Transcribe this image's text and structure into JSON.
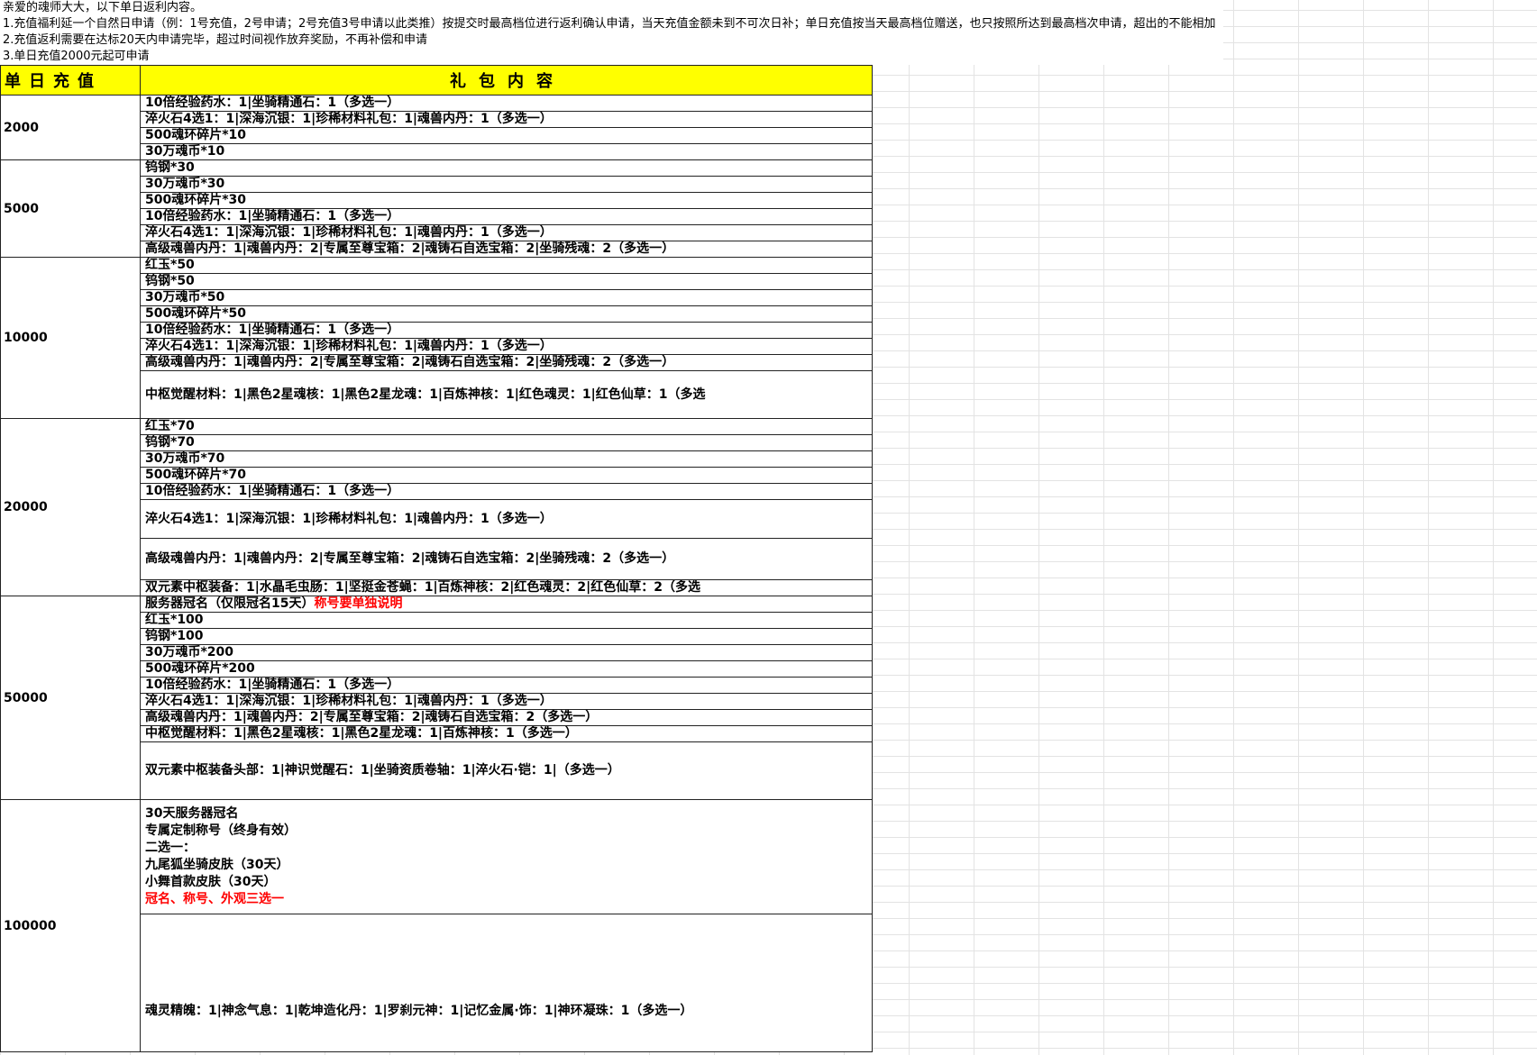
{
  "notes": [
    "亲爱的魂师大大，以下单日返利内容。",
    "1.充值福利延一个自然日申请（例：1号充值，2号申请；2号充值3号申请以此类推）按提交时最高档位进行返利确认申请，当天充值金额未到不可次日补；单日充值按当天最高档位赠送，也只按照所达到最高档次申请，超出的不能相加",
    "2.充值返利需要在达标20天内申请完毕，超过时间视作放弃奖励，不再补偿和申请",
    "3.单日充值2000元起可申请"
  ],
  "table": {
    "header_tier": "单日充值",
    "header_content": "礼包内容",
    "tiers": [
      {
        "amount": "2000",
        "items": [
          "10倍经验药水：1|坐骑精通石：1（多选一）",
          "淬火石4选1：1|深海沉银：1|珍稀材料礼包：1|魂兽内丹：1（多选一）",
          "500魂环碎片*10",
          "30万魂币*10"
        ]
      },
      {
        "amount": "5000",
        "items": [
          "钨钢*30",
          "30万魂币*30",
          "500魂环碎片*30",
          "10倍经验药水：1|坐骑精通石：1（多选一）",
          "淬火石4选1：1|深海沉银：1|珍稀材料礼包：1|魂兽内丹：1（多选一）",
          "高级魂兽内丹：1|魂兽内丹：2|专属至尊宝箱：2|魂铸石自选宝箱：2|坐骑残魂：2（多选一）"
        ]
      },
      {
        "amount": "10000",
        "items": [
          "红玉*50",
          "钨钢*50",
          "30万魂币*50",
          "500魂环碎片*50",
          "10倍经验药水：1|坐骑精通石：1（多选一）",
          "淬火石4选1：1|深海沉银：1|珍稀材料礼包：1|魂兽内丹：1（多选一）",
          "高级魂兽内丹：1|魂兽内丹：2|专属至尊宝箱：2|魂铸石自选宝箱：2|坐骑残魂：2（多选一）",
          "中枢觉醒材料：1|黑色2星魂核：1|黑色2星龙魂：1|百炼神核：1|红色魂灵：1|红色仙草：1（多选"
        ]
      },
      {
        "amount": "20000",
        "items": [
          "红玉*70",
          "钨钢*70",
          "30万魂币*70",
          "500魂环碎片*70",
          "10倍经验药水：1|坐骑精通石：1（多选一）",
          "淬火石4选1：1|深海沉银：1|珍稀材料礼包：1|魂兽内丹：1（多选一）",
          "高级魂兽内丹：1|魂兽内丹：2|专属至尊宝箱：2|魂铸石自选宝箱：2|坐骑残魂：2（多选一）",
          "双元素中枢装备：1|水晶毛虫肠：1|坚挺金苍蝇：1|百炼神核：2|红色魂灵：2|红色仙草：2（多选"
        ]
      },
      {
        "amount": "50000",
        "title_item": "服务器冠名（仅限冠名15天）",
        "title_item_red": "称号要单独说明",
        "items": [
          "红玉*100",
          "钨钢*100",
          "30万魂币*200",
          "500魂环碎片*200",
          "10倍经验药水：1|坐骑精通石：1（多选一）",
          "淬火石4选1：1|深海沉银：1|珍稀材料礼包：1|魂兽内丹：1（多选一）",
          "高级魂兽内丹：1|魂兽内丹：2|专属至尊宝箱：2|魂铸石自选宝箱：2（多选一）",
          "中枢觉醒材料：1|黑色2星魂核：1|黑色2星龙魂：1|百炼神核：1（多选一）",
          "双元素中枢装备头部：1|神识觉醒石：1|坐骑资质卷轴：1|淬火石·铠：1|（多选一）"
        ]
      },
      {
        "amount": "100000",
        "multi_lines": [
          "30天服务器冠名",
          "专属定制称号（终身有效）",
          "二选一：",
          "九尾狐坐骑皮肤（30天）",
          "小舞首款皮肤（30天）"
        ],
        "multi_red": "冠名、称号、外观三选一",
        "items": [
          "魂灵精魄：1|神念气息：1|乾坤造化丹：1|罗刹元神：1|记忆金属·饰：1|神环凝珠：1（多选一）"
        ]
      }
    ]
  }
}
